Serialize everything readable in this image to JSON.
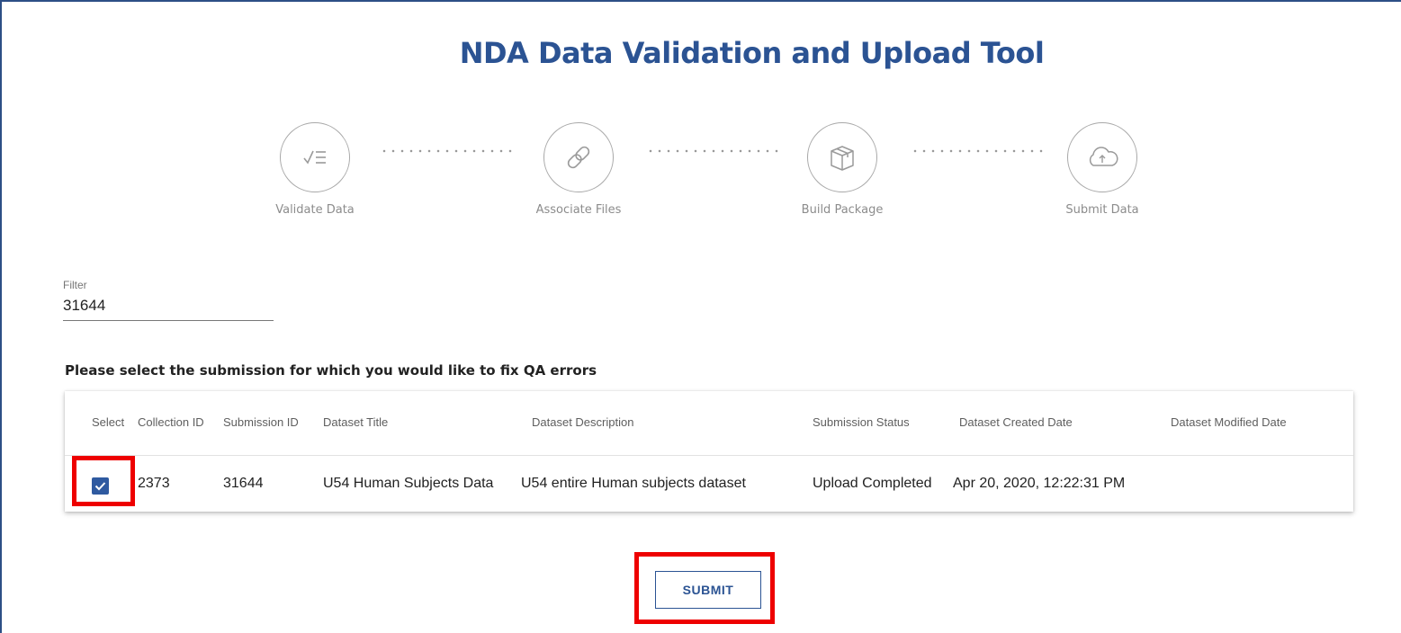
{
  "app": {
    "title": "NDA Data Validation and Upload Tool"
  },
  "steps": [
    {
      "label": "Validate Data",
      "icon": "checklist-icon"
    },
    {
      "label": "Associate Files",
      "icon": "link-icon"
    },
    {
      "label": "Build Package",
      "icon": "package-icon"
    },
    {
      "label": "Submit Data",
      "icon": "cloud-upload-icon"
    }
  ],
  "filter": {
    "label": "Filter",
    "value": "31644"
  },
  "instructions": "Please select the submission for which you would like to fix QA errors",
  "table": {
    "columns": [
      "Select",
      "Collection ID",
      "Submission ID",
      "Dataset Title",
      "Dataset Description",
      "Submission Status",
      "Dataset Created Date",
      "Dataset Modified Date"
    ],
    "rows": [
      {
        "selected": true,
        "collection_id": "2373",
        "submission_id": "31644",
        "dataset_title": "U54 Human Subjects Data",
        "dataset_description": "U54 entire Human subjects dataset",
        "submission_status": "Upload Completed",
        "created_date": "Apr 20, 2020, 12:22:31 PM",
        "modified_date": ""
      }
    ]
  },
  "actions": {
    "submit_label": "SUBMIT"
  },
  "colors": {
    "brand": "#2b5393",
    "highlight": "#ee0000",
    "checkbox": "#2f5aa0"
  }
}
